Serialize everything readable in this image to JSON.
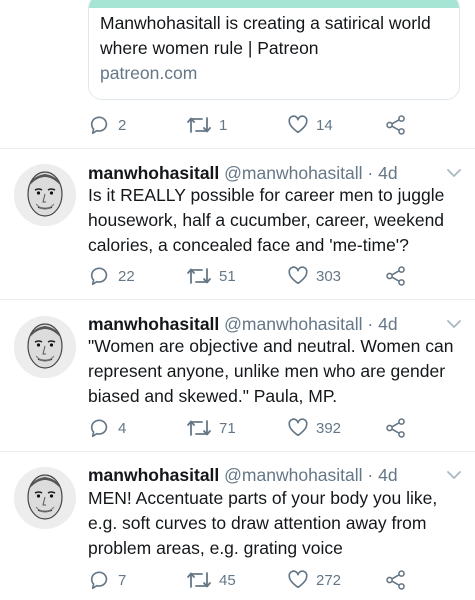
{
  "link_card": {
    "title": "Manwhohasitall is creating a satirical world where women rule | Patreon",
    "domain": "patreon.com"
  },
  "top_actions": {
    "replies": "2",
    "retweets": "1",
    "likes": "14"
  },
  "tweets": [
    {
      "name": "manwhohasitall",
      "handle": "@manwhohasitall",
      "separator": "·",
      "time": "4d",
      "text": "Is it REALLY possible for career men to juggle housework, half a cucumber, career, weekend calories, a concealed face and 'me-time'?",
      "replies": "22",
      "retweets": "51",
      "likes": "303"
    },
    {
      "name": "manwhohasitall",
      "handle": "@manwhohasitall",
      "separator": "·",
      "time": "4d",
      "text": "\"Women are objective and neutral. Women can represent anyone, unlike men who are gender biased and skewed.\" Paula, MP.",
      "replies": "4",
      "retweets": "71",
      "likes": "392"
    },
    {
      "name": "manwhohasitall",
      "handle": "@manwhohasitall",
      "separator": "·",
      "time": "4d",
      "text": "MEN! Accentuate parts of your body you like, e.g. soft curves to draw attention away from problem areas, e.g. grating voice",
      "replies": "7",
      "retweets": "45",
      "likes": "272"
    }
  ],
  "colors": {
    "secondary_text": "#657786",
    "primary_text": "#14171a",
    "divider": "#e6ecf0",
    "card_accent": "#a6e4d4"
  },
  "icons": {
    "reply": "reply-icon",
    "retweet": "retweet-icon",
    "like": "like-icon",
    "share": "share-icon",
    "menu": "chevron-down-icon"
  }
}
